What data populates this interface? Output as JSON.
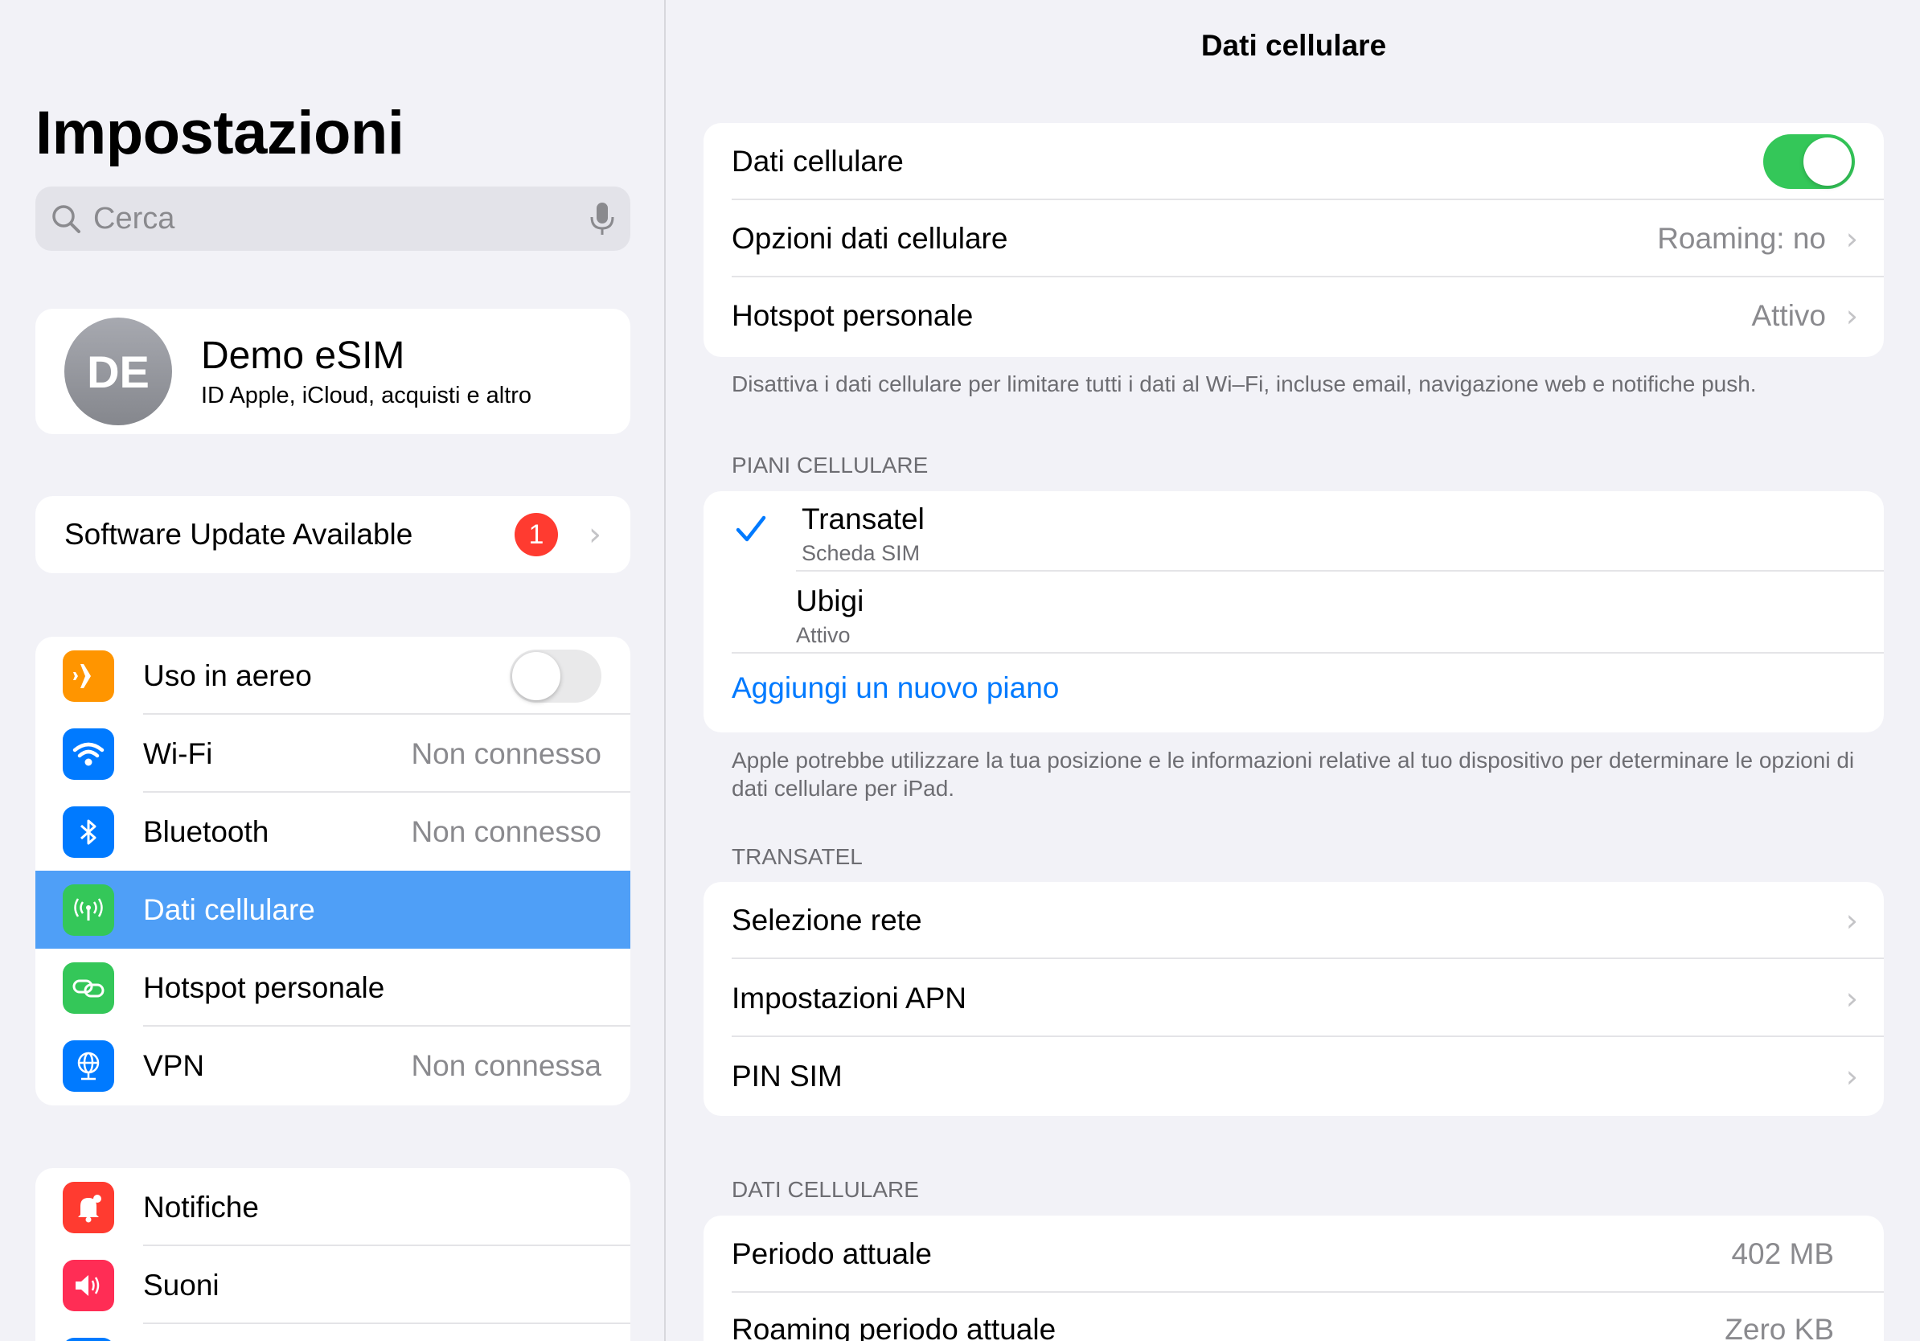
{
  "sidebar": {
    "title": "Impostazioni",
    "search_placeholder": "Cerca",
    "profile": {
      "initials": "DE",
      "name": "Demo eSIM",
      "subtitle": "ID Apple, iCloud, acquisti e altro"
    },
    "update": {
      "label": "Software Update Available",
      "badge": "1"
    },
    "connectivity": [
      {
        "label": "Uso in aereo",
        "value": "",
        "icon": "airplane-icon",
        "color": "#ff9500",
        "toggle": "off"
      },
      {
        "label": "Wi-Fi",
        "value": "Non connesso",
        "icon": "wifi-icon",
        "color": "#007aff"
      },
      {
        "label": "Bluetooth",
        "value": "Non connesso",
        "icon": "bluetooth-icon",
        "color": "#007aff"
      },
      {
        "label": "Dati cellulare",
        "value": "",
        "icon": "cellular-antenna-icon",
        "color": "#34c759",
        "selected": true
      },
      {
        "label": "Hotspot personale",
        "value": "",
        "icon": "hotspot-link-icon",
        "color": "#34c759"
      },
      {
        "label": "VPN",
        "value": "Non connessa",
        "icon": "vpn-globe-icon",
        "color": "#007aff"
      }
    ],
    "notifications": [
      {
        "label": "Notifiche",
        "icon": "bell-icon",
        "color": "#ff3b30"
      },
      {
        "label": "Suoni",
        "icon": "speaker-icon",
        "color": "#ff2d55"
      }
    ]
  },
  "detail": {
    "title": "Dati cellulare",
    "main_rows": [
      {
        "label": "Dati cellulare",
        "toggle": "on"
      },
      {
        "label": "Opzioni dati cellulare",
        "value": "Roaming: no"
      },
      {
        "label": "Hotspot personale",
        "value": "Attivo"
      }
    ],
    "main_footer": "Disattiva i dati cellulare per limitare tutti i dati al Wi–Fi, incluse email, navigazione web e notifiche push.",
    "plans_header": "PIANI CELLULARE",
    "plans": [
      {
        "name": "Transatel",
        "sub": "Scheda SIM",
        "selected": true
      },
      {
        "name": "Ubigi",
        "sub": "Attivo",
        "selected": false
      }
    ],
    "add_plan": "Aggiungi un nuovo piano",
    "plans_footer": "Apple potrebbe utilizzare la tua posizione e le informazioni relative al tuo dispositivo per determinare le opzioni di dati cellulare per iPad.",
    "transatel_header": "TRANSATEL",
    "transatel_rows": [
      {
        "label": "Selezione rete"
      },
      {
        "label": "Impostazioni APN"
      },
      {
        "label": "PIN SIM"
      }
    ],
    "usage_header": "DATI CELLULARE",
    "usage_rows": [
      {
        "label": "Periodo attuale",
        "value": "402 MB"
      },
      {
        "label": "Roaming periodo attuale",
        "value": "Zero KB"
      }
    ]
  },
  "colors": {
    "accent": "#007aff",
    "toggle_on": "#34c759",
    "selection": "#4f9ff7",
    "badge": "#ff3b30"
  }
}
